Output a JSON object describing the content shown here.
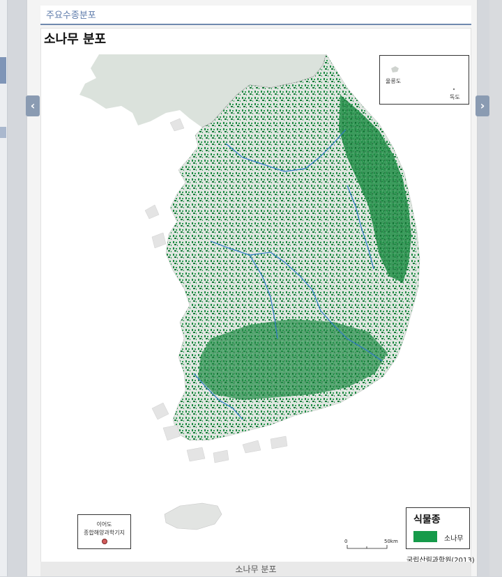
{
  "section": {
    "title": "주요수종분포"
  },
  "map": {
    "title": "소나무 분포",
    "caption": "소나무 분포",
    "source": "국립산림과학원(2013)",
    "inset": {
      "ulleungdo": "울릉도",
      "dokdo": "독도"
    },
    "ieodo": {
      "line1": "이어도",
      "line2": "종합해양과학기지"
    },
    "legend": {
      "title": "식물종",
      "item_label": "소나무",
      "item_color": "#169a4a"
    },
    "scale": {
      "start": "0",
      "end": "50km"
    }
  },
  "nav": {
    "prev_icon": "chevron-left-icon",
    "next_icon": "chevron-right-icon"
  }
}
